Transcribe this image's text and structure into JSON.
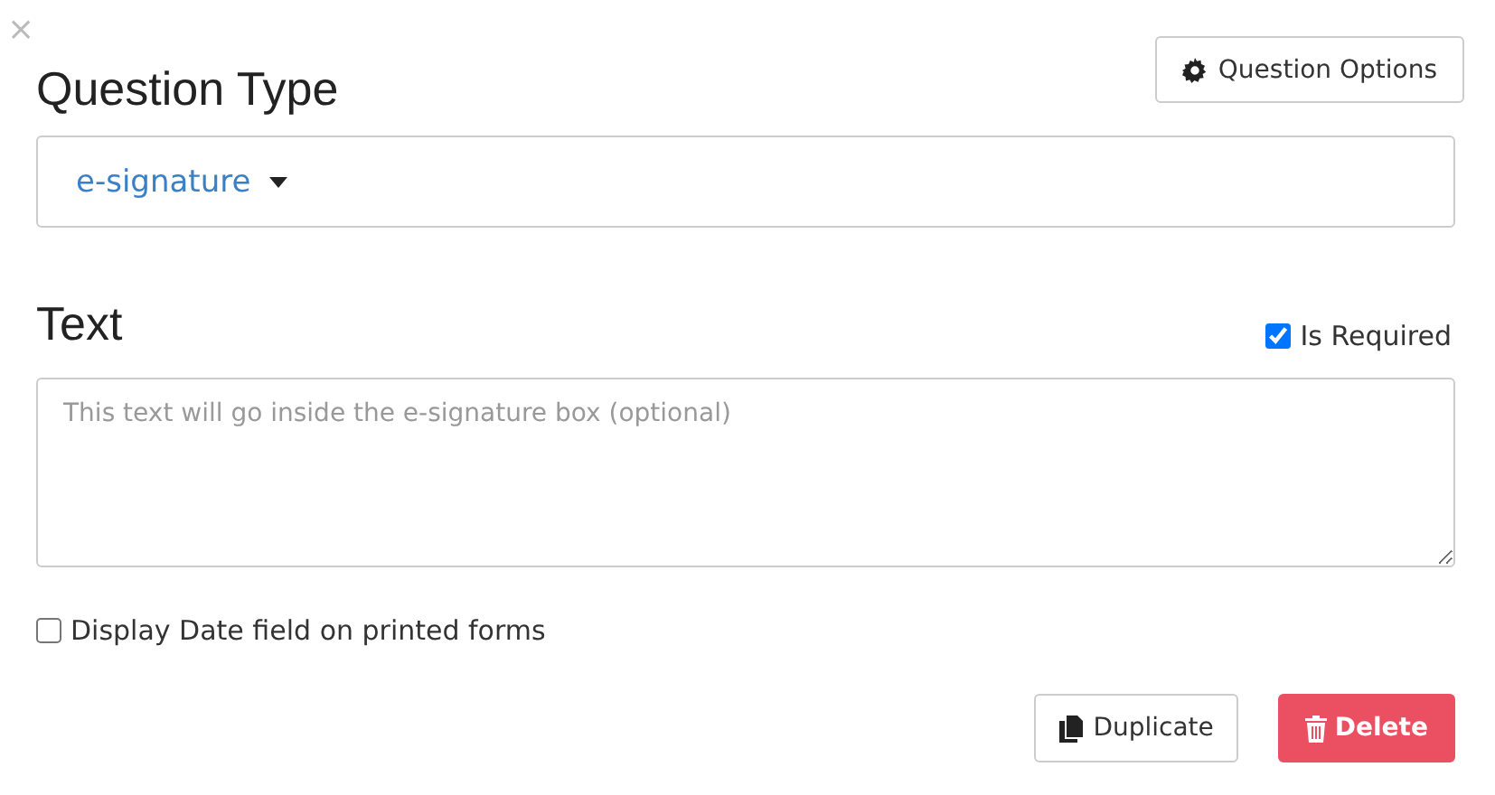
{
  "close": "×",
  "options_button": "Question Options",
  "question_type": {
    "label": "Question Type",
    "value": "e-signature"
  },
  "text_section": {
    "label": "Text",
    "required": {
      "label": "Is Required",
      "checked": true
    },
    "placeholder": "This text will go inside the e-signature box (optional)"
  },
  "display_date": {
    "label": "Display Date field on printed forms",
    "checked": false
  },
  "buttons": [
    {
      "kind": "duplicate",
      "label": "Duplicate"
    },
    {
      "kind": "delete",
      "label": "Delete"
    }
  ]
}
